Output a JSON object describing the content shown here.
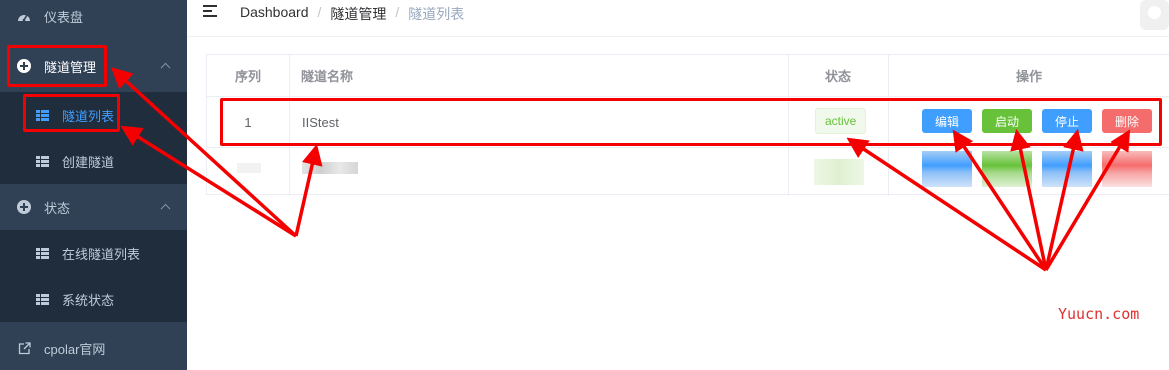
{
  "sidebar": {
    "items": [
      {
        "label": "仪表盘",
        "icon": "dashboard-icon"
      },
      {
        "label": "隧道管理",
        "icon": "plus-circle-icon"
      },
      {
        "label": "隧道列表",
        "icon": "table-icon"
      },
      {
        "label": "创建隧道",
        "icon": "table-icon"
      },
      {
        "label": "状态",
        "icon": "plus-circle-icon"
      },
      {
        "label": "在线隧道列表",
        "icon": "table-icon"
      },
      {
        "label": "系统状态",
        "icon": "table-icon"
      },
      {
        "label": "cpolar官网",
        "icon": "external-link-icon"
      }
    ]
  },
  "header": {
    "breadcrumb": [
      "Dashboard",
      "隧道管理",
      "隧道列表"
    ],
    "separator": "/"
  },
  "table": {
    "columns": [
      "序列",
      "隧道名称",
      "状态",
      "操作"
    ],
    "rows": [
      {
        "index": "1",
        "name": "IIStest",
        "status": "active",
        "actions": [
          "编辑",
          "启动",
          "停止",
          "删除"
        ]
      }
    ]
  },
  "colors": {
    "sidebar_bg": "#304156",
    "submenu_bg": "#1f2d3d",
    "accent": "#409eff",
    "success": "#67c23a",
    "danger": "#f56c6c",
    "annotation": "#f40000"
  },
  "watermark": "Yuucn.com"
}
